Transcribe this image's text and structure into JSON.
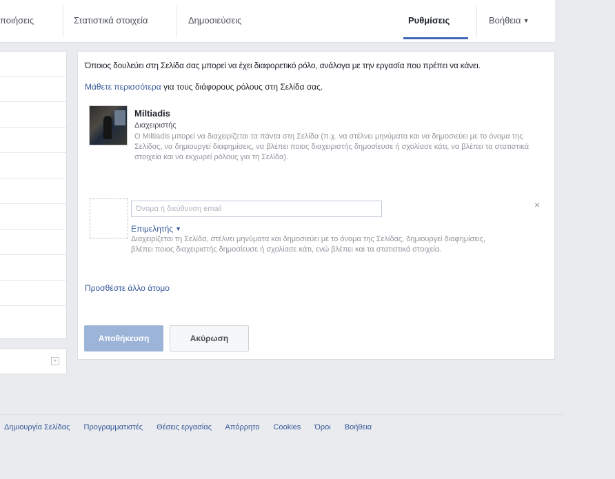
{
  "tabs": [
    {
      "label": "ποιήσεις"
    },
    {
      "label": "Στατιστικά στοιχεία"
    },
    {
      "label": "Δημοσιεύσεις"
    },
    {
      "label": "Ρυθμίσεις"
    },
    {
      "label": "Βοήθεια"
    }
  ],
  "roles_panel": {
    "intro_text": "Όποιος δουλεύει στη Σελίδα σας μπορεί να έχει διαφορετικό ρόλο, ανάλογα με την εργασία που πρέπει να κάνει.",
    "learn_more_link": "Μάθετε περισσότερα",
    "learn_more_rest": " για τους διάφορους ρόλους στη Σελίδα σας.",
    "user": {
      "name": "Miltiadis",
      "role": "Διαχειριστής",
      "description": "Ο Miltiadis μπορεί να διαχειρίζεται τα πάντα στη Σελίδα (π.χ. να στέλνει μηνύματα και να δημοσιεύει με το όνομα της Σελίδας, να δημιουργεί διαφημίσεις, να βλέπει ποιος διαχειριστής δημοσίευσε ή σχολίασε κάτι, να βλέπει τα στατιστικά στοιχεία και να εκχωρεί ρόλους για τη Σελίδα)."
    },
    "new_person": {
      "email_placeholder": "Όνομα ή διεύθυνση email",
      "role_label": "Επιμελητής",
      "role_description": "Διαχειρίζεται τη Σελίδα, στέλνει μηνύματα και δημοσιεύει με το όνομα της Σελίδας, δημιουργεί διαφημίσεις, βλέπει ποιος διαχειριστής δημοσίευσε ή σχολίασε κάτι, ενώ βλέπει και τα στατιστικά στοιχεία.",
      "remove_symbol": "×"
    },
    "add_person_link": "Προσθέστε άλλο άτομο",
    "save_label": "Αποθήκευση",
    "cancel_label": "Ακύρωση"
  },
  "footer_links": [
    "Δημιουργία Σελίδας",
    "Προγραμματιστές",
    "Θέσεις εργασίας",
    "Απόρρητο",
    "Cookies",
    "Όροι",
    "Βοήθεια"
  ],
  "colors": {
    "link": "#365899",
    "accent": "#4267b2",
    "save_button_disabled": "#9cb4d8",
    "background": "#e9ebee"
  }
}
